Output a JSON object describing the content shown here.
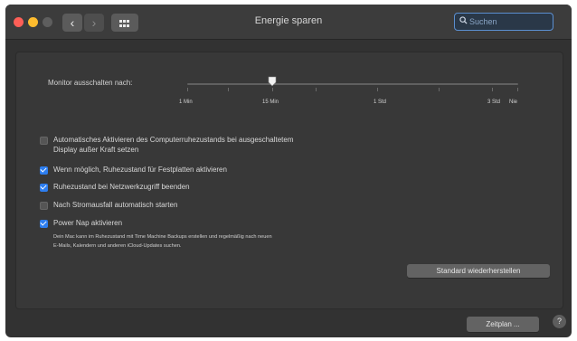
{
  "window": {
    "title": "Energie sparen"
  },
  "toolbar": {
    "back_icon": "chevron-left-icon",
    "forward_icon": "chevron-right-icon",
    "grid_icon": "show-all-grid-icon",
    "search_placeholder": "Suchen"
  },
  "display_sleep": {
    "label": "Monitor ausschalten nach:",
    "tick_labels": [
      "1 Min",
      "15 Min",
      "1 Std",
      "3 Std",
      "Nie"
    ],
    "value": "15 Min"
  },
  "options": [
    {
      "label_line1": "Automatisches Aktivieren des Computerruhezustands bei ausgeschaltetem",
      "label_line2": "Display außer Kraft setzen",
      "checked": false
    },
    {
      "label": "Wenn möglich, Ruhezustand für Festplatten aktivieren",
      "checked": true
    },
    {
      "label": "Ruhezustand bei Netzwerkzugriff beenden",
      "checked": true
    },
    {
      "label": "Nach Stromausfall automatisch starten",
      "checked": false
    },
    {
      "label": "Power Nap aktivieren",
      "checked": true
    }
  ],
  "power_nap_note": {
    "line1": "Dein Mac kann im Ruhezustand mit Time Machine Backups erstellen und regelmäßig nach neuen",
    "line2": "E-Mails, Kalendern und anderen iCloud-Updates suchen."
  },
  "buttons": {
    "restore_defaults": "Standard wiederherstellen",
    "schedule": "Zeitplan ...",
    "help": "?"
  },
  "colors": {
    "accent": "#2d7ef0",
    "window_bg": "#323232",
    "panel_bg": "#383838"
  }
}
